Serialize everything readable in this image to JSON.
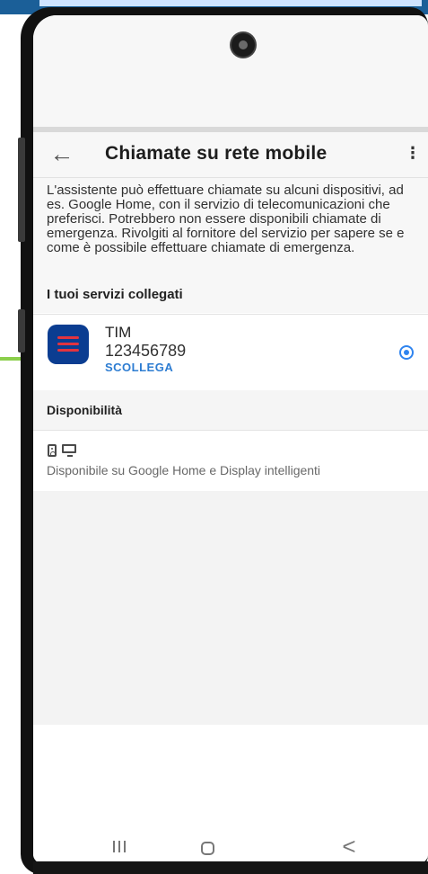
{
  "header": {
    "title": "Chiamate su rete mobile",
    "back_icon": "arrow-left-icon",
    "menu_icon": "more-vertical-icon",
    "back_glyph": "←",
    "menu_glyph": "⋮"
  },
  "description": {
    "text": "L'assistente può effettuare chiamate su alcuni dispositivi, ad es. Google Home, con il servizio di telecomunicazioni che preferisci. Potrebbero non essere disponibili chiamate di emergenza. Rivolgiti al fornitore del servizio per sapere se e come è possibile effettuare chiamate di emergenza."
  },
  "services": {
    "section_title": "I tuoi servizi collegati",
    "items": [
      {
        "name": "TIM",
        "number": "123456789",
        "action_label": "SCOLLEGA",
        "selected": true,
        "logo_icon": "tim-logo-icon",
        "radio_color": "#2f84ef"
      }
    ]
  },
  "availability": {
    "section_title": "Disponibilità",
    "icons": [
      "speaker-icon",
      "display-icon"
    ],
    "text": "Disponibile su Google Home e Display intelligenti"
  },
  "system_navigation": {
    "recents_icon": "recents-icon",
    "home_icon": "home-icon",
    "back_icon": "back-chevron-icon",
    "back_glyph": "<"
  },
  "colors": {
    "accent": "#2f84ef",
    "tim_blue": "#0b3d91",
    "tim_red": "#e2343f",
    "link": "#2e7dd2"
  }
}
